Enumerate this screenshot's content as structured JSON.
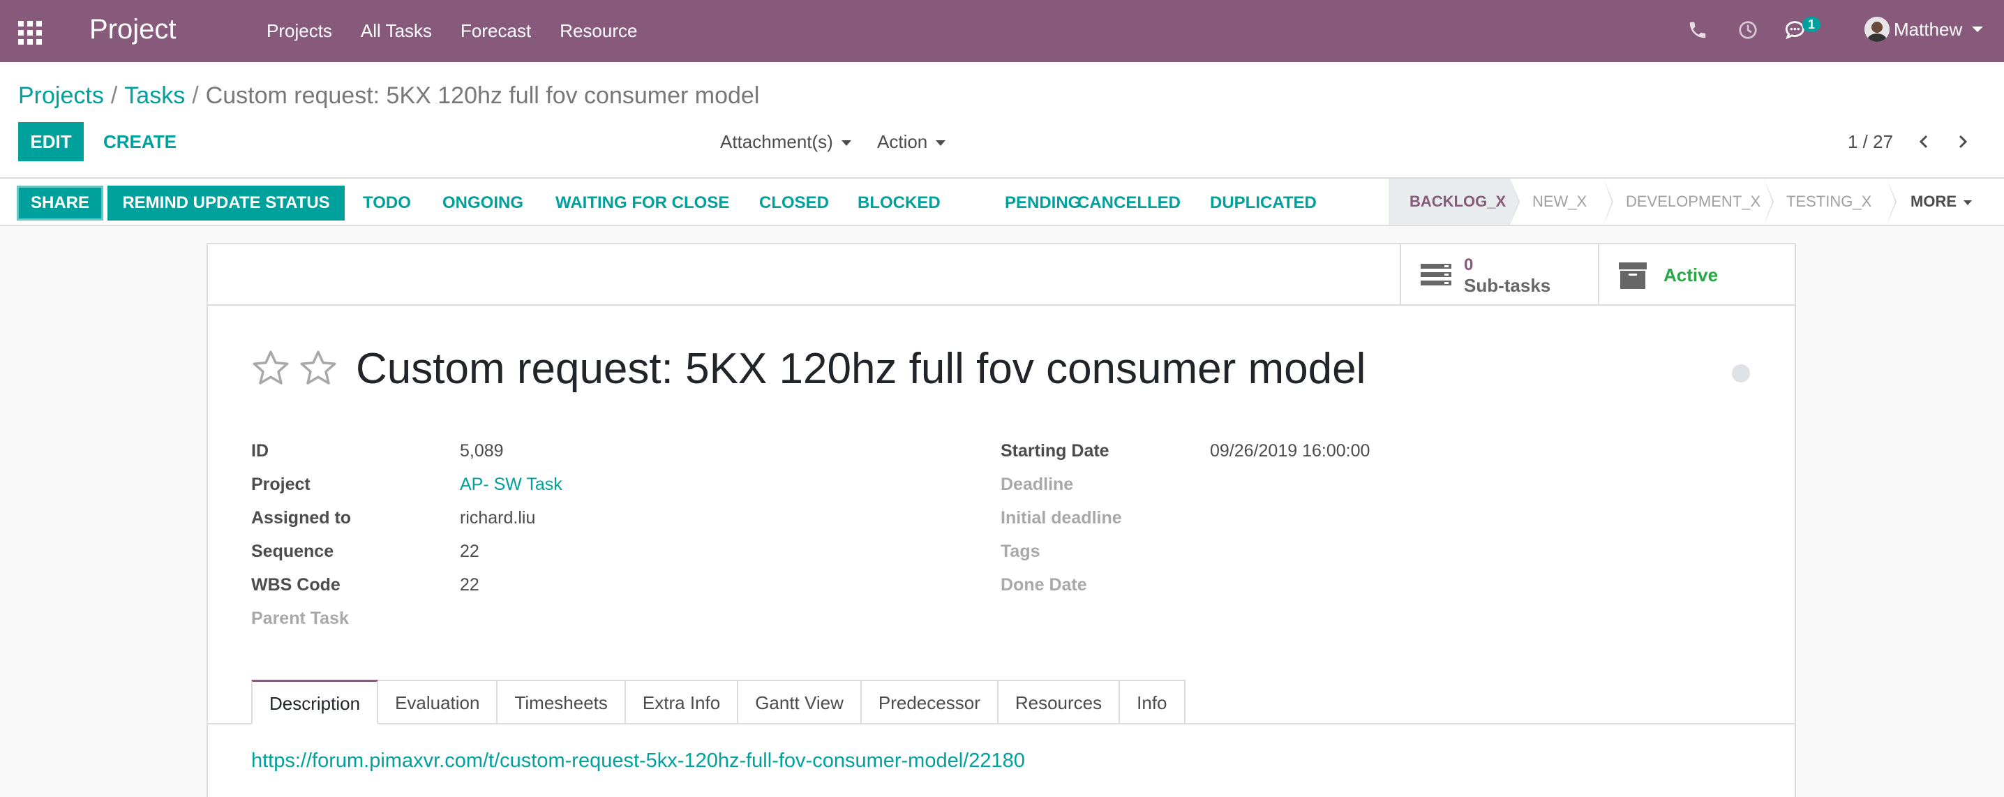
{
  "navbar": {
    "brand": "Project",
    "menu": [
      "Projects",
      "All Tasks",
      "Forecast",
      "Resource"
    ],
    "chat_badge": "1",
    "user_name": "Matthew",
    "bg_color": "#875a7b"
  },
  "breadcrumb": {
    "items": [
      "Projects",
      "Tasks"
    ],
    "separator": "/",
    "current": "Custom request: 5KX 120hz full fov consumer model"
  },
  "control": {
    "edit_label": "EDIT",
    "create_label": "CREATE",
    "attachments_label": "Attachment(s)",
    "action_label": "Action",
    "pager": "1 / 27"
  },
  "statusbar": {
    "share_label": "SHARE",
    "remind_label": "REMIND UPDATE STATUS",
    "state_buttons": [
      "TODO",
      "ONGOING",
      "WAITING FOR CLOSE",
      "CLOSED",
      "BLOCKED",
      "PENDING",
      "CANCELLED",
      "DUPLICATED"
    ],
    "stages": [
      "BACKLOG_X",
      "NEW_X",
      "DEVELOPMENT_X",
      "TESTING_X"
    ],
    "active_stage": "BACKLOG_X",
    "more_label": "MORE",
    "accent_color": "#00a09d"
  },
  "stat_buttons": {
    "subtasks_count": "0",
    "subtasks_label": "Sub-tasks",
    "active_label": "Active"
  },
  "task": {
    "title": "Custom request: 5KX 120hz full fov consumer model",
    "left_fields": [
      {
        "label": "ID",
        "value": "5,089"
      },
      {
        "label": "Project",
        "value": "AP- SW Task"
      },
      {
        "label": "Assigned to",
        "value": "richard.liu"
      },
      {
        "label": "Sequence",
        "value": "22"
      },
      {
        "label": "WBS Code",
        "value": "22"
      },
      {
        "label": "Parent Task",
        "value": ""
      }
    ],
    "right_fields": [
      {
        "label": "Starting Date",
        "value": "09/26/2019 16:00:00"
      },
      {
        "label": "Deadline",
        "value": ""
      },
      {
        "label": "Initial deadline",
        "value": ""
      },
      {
        "label": "Tags",
        "value": ""
      },
      {
        "label": "Done Date",
        "value": ""
      }
    ]
  },
  "notebook": {
    "tabs": [
      "Description",
      "Evaluation",
      "Timesheets",
      "Extra Info",
      "Gantt View",
      "Predecessor",
      "Resources",
      "Info"
    ],
    "active_tab": "Description",
    "description_link": "https://forum.pimaxvr.com/t/custom-request-5kx-120hz-full-fov-consumer-model/22180"
  }
}
